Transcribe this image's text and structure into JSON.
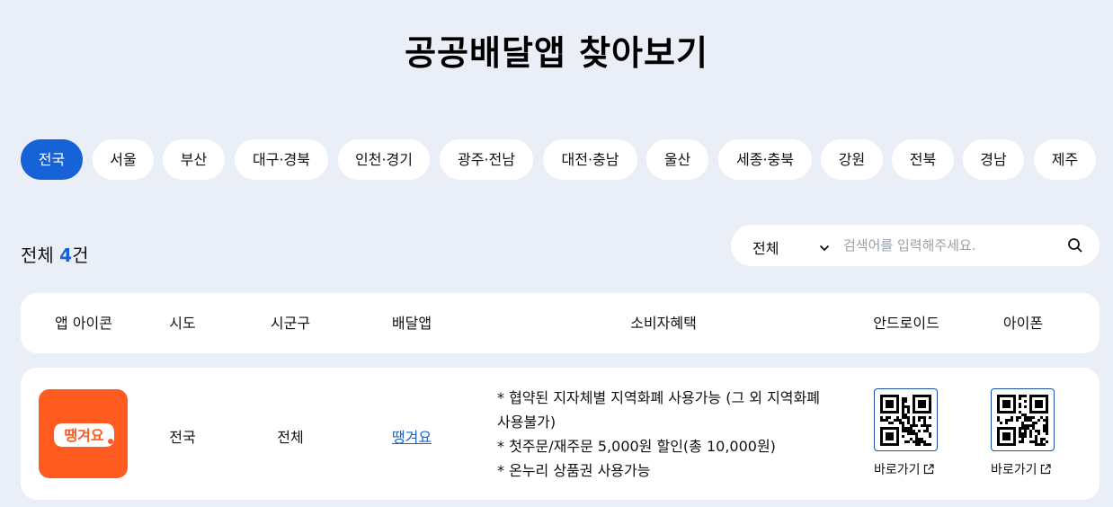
{
  "page": {
    "title": "공공배달앱 찾아보기"
  },
  "regions": [
    {
      "label": "전국",
      "active": true
    },
    {
      "label": "서울"
    },
    {
      "label": "부산"
    },
    {
      "label": "대구·경북"
    },
    {
      "label": "인천·경기"
    },
    {
      "label": "광주·전남"
    },
    {
      "label": "대전·충남"
    },
    {
      "label": "울산"
    },
    {
      "label": "세종·충북"
    },
    {
      "label": "강원"
    },
    {
      "label": "전북"
    },
    {
      "label": "경남"
    },
    {
      "label": "제주"
    }
  ],
  "summary": {
    "prefix": "전체 ",
    "count": "4",
    "suffix": "건"
  },
  "search": {
    "filter_value": "전체",
    "placeholder": "검색어를 입력해주세요.",
    "filter_icon": "chevron-down-icon",
    "button_icon": "search-icon"
  },
  "table": {
    "headers": [
      "앱 아이콘",
      "시도",
      "시군구",
      "배달앱",
      "소비자혜택",
      "안드로이드",
      "아이폰"
    ],
    "rows": [
      {
        "app_icon_text": "땡겨요",
        "sido": "전국",
        "sigungu": "전체",
        "app_name": "땡겨요",
        "benefits": [
          "* 협약된 지자체별 지역화폐 사용가능 (그 외 지역화폐",
          "사용불가)",
          "* 첫주문/재주문 5,000원 할인(총 10,000원)",
          "* 온누리 상품권 사용가능"
        ],
        "android_link": "바로가기",
        "ios_link": "바로가기"
      }
    ]
  },
  "colors": {
    "accent": "#1563d6",
    "background": "#e9eef7",
    "app_brand": "#ff5a1f"
  }
}
